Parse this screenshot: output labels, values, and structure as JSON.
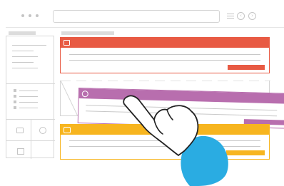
{
  "browser": {
    "dots_color": "#c4c4c4",
    "chrome_color": "#dcdcdc"
  },
  "cards": [
    {
      "id": "card-1",
      "accent": "#e85a43",
      "icon": "window-icon"
    },
    {
      "id": "card-2",
      "accent": "#b86eae",
      "icon": "play-icon"
    },
    {
      "id": "card-3",
      "accent": "#f7b51f",
      "icon": "settings-icon"
    }
  ],
  "hand": {
    "sleeve_color": "#2aace2"
  },
  "sidebar": {
    "icons": [
      "video-icon",
      "gear-icon",
      "calendar-icon"
    ]
  }
}
